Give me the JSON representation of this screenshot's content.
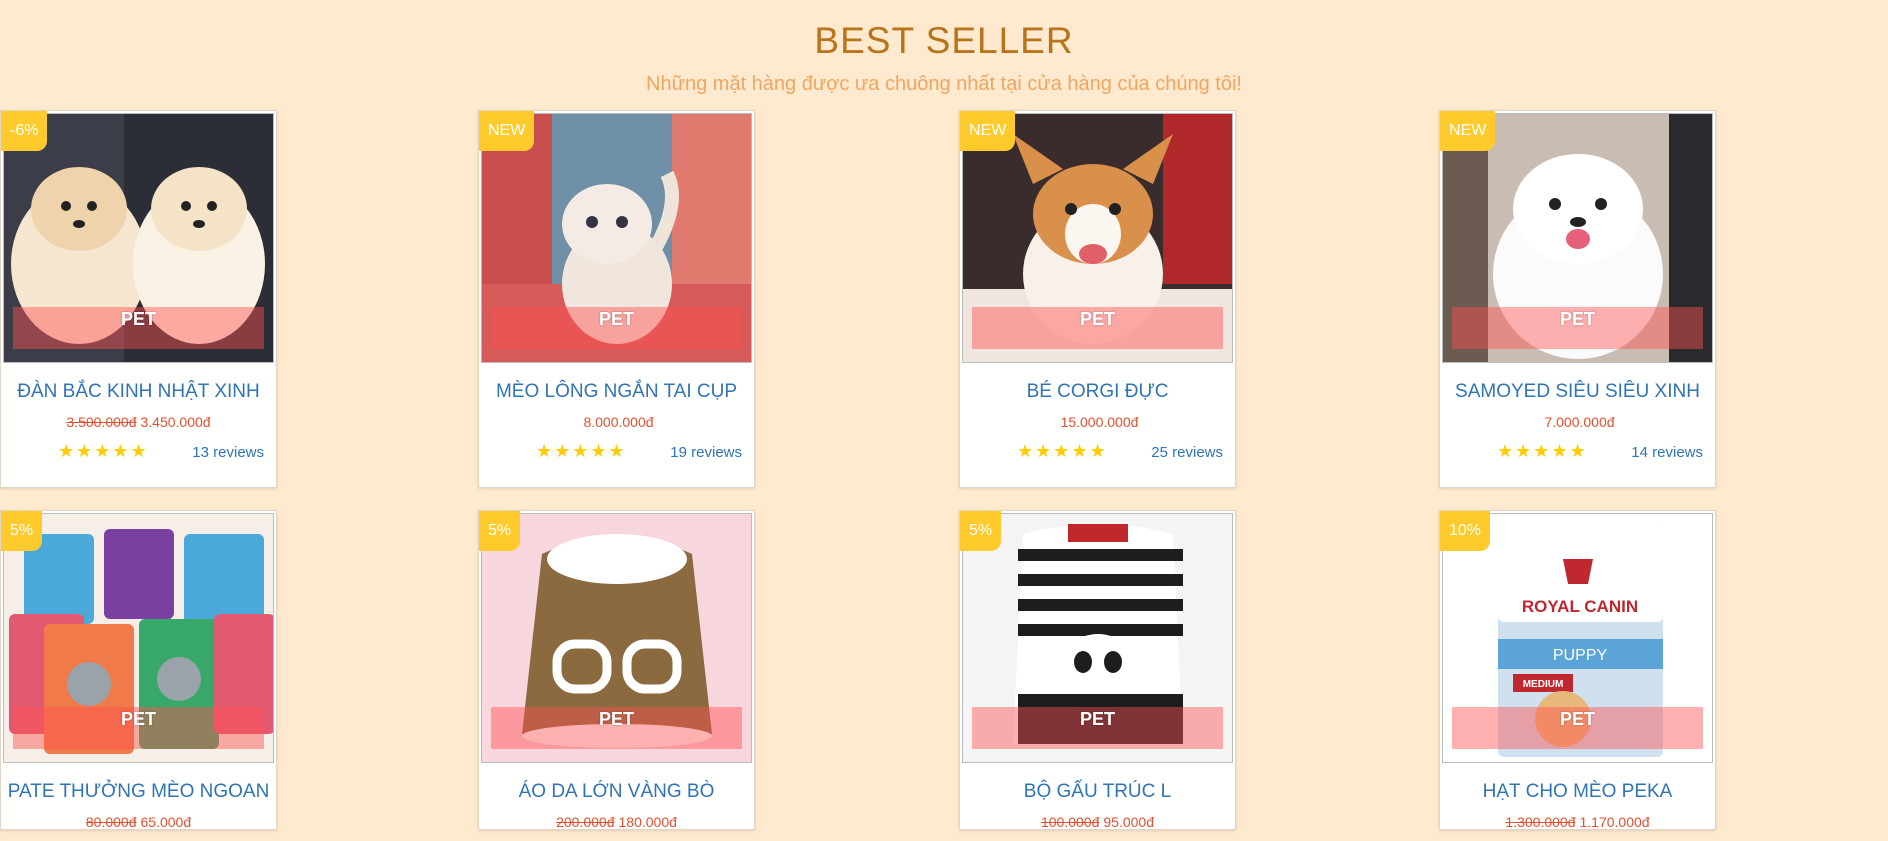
{
  "header": {
    "title": "BEST SELLER",
    "subtitle": "Những mặt hàng được ưa chuông nhất tại cửa hàng của chúng tôi!"
  },
  "products": [
    {
      "badge": "-6%",
      "category": "PET",
      "name": "ĐÀN BẮC KINH NHẬT XINH",
      "old_price": "3.500.000đ",
      "price": "3.450.000đ",
      "stars": "★★★★★",
      "reviews": "13 reviews",
      "image": "two fluffy puppies"
    },
    {
      "badge": "NEW",
      "category": "PET",
      "name": "MÈO LÔNG NGẮN TAI CỤP",
      "old_price": "",
      "price": "8.000.000đ",
      "stars": "★★★★★",
      "reviews": "19 reviews",
      "image": "white kitten"
    },
    {
      "badge": "NEW",
      "category": "PET",
      "name": "BÉ CORGI ĐỰC",
      "old_price": "",
      "price": "15.000.000đ",
      "stars": "★★★★★",
      "reviews": "25 reviews",
      "image": "corgi puppy"
    },
    {
      "badge": "NEW",
      "category": "PET",
      "name": "SAMOYED SIÊU SIÊU XINH",
      "old_price": "",
      "price": "7.000.000đ",
      "stars": "★★★★★",
      "reviews": "14 reviews",
      "image": "white samoyed puppy"
    },
    {
      "badge": "5%",
      "category": "PET",
      "name": "PATE THƯỞNG MÈO NGOAN",
      "old_price": "80.000đ",
      "price": "65.000đ",
      "image": "cat food pouches"
    },
    {
      "badge": "5%",
      "category": "PET",
      "name": "ÁO DA LỚN VÀNG BÒ",
      "old_price": "200.000đ",
      "price": "180.000đ",
      "image": "brown pet jacket"
    },
    {
      "badge": "5%",
      "category": "PET",
      "name": "BỘ GẤU TRÚC L",
      "old_price": "100.000đ",
      "price": "95.000đ",
      "image": "panda striped outfit"
    },
    {
      "badge": "10%",
      "category": "PET",
      "name": "HẠT CHO MÈO PEKA",
      "old_price": "1.300.000đ",
      "price": "1.170.000đ",
      "image": "royal canin puppy bag",
      "image_text": [
        "ROYAL CANIN",
        "PUPPY",
        "MEDIUM"
      ]
    }
  ],
  "colors": {
    "background": "#ffe9cf",
    "title": "#b8741a",
    "subtitle": "#f0a660",
    "badge": "#ffcb2c",
    "name": "#2f74b6",
    "price": "#e0502f",
    "star": "#ffcc00"
  }
}
